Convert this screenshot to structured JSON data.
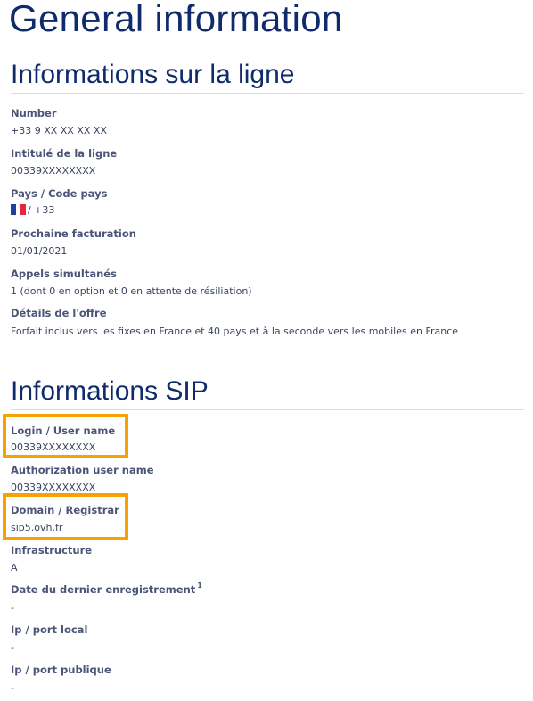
{
  "page": {
    "title": "General information"
  },
  "line_section": {
    "title": "Informations sur la ligne",
    "fields": [
      {
        "label": "Number",
        "value": "+33 9 XX XX XX XX"
      },
      {
        "label": "Intitulé de la ligne",
        "value": "00339XXXXXXXX"
      },
      {
        "label": "Pays / Code pays",
        "value": "/ +33"
      },
      {
        "label": "Prochaine facturation",
        "value": "01/01/2021"
      },
      {
        "label": "Appels simultanés",
        "value": "1 (dont 0 en option et 0 en attente de résiliation)"
      },
      {
        "label": "Détails de l'offre",
        "value": "Forfait inclus vers les fixes en France et 40 pays et à la seconde vers les mobiles en France"
      }
    ]
  },
  "sip_section": {
    "title": "Informations SIP",
    "fields": [
      {
        "label": "Login / User name",
        "value": "00339XXXXXXXX"
      },
      {
        "label": "Authorization user name",
        "value": "00339XXXXXXXX"
      },
      {
        "label": "Domain / Registrar",
        "value": "sip5.ovh.fr"
      },
      {
        "label": "Infrastructure",
        "value": "A"
      },
      {
        "label": "Date du dernier enregistrement",
        "footnote": "1",
        "value": "-"
      },
      {
        "label": "Ip / port local",
        "value": "-"
      },
      {
        "label": "Ip / port publique",
        "value": "-"
      }
    ]
  },
  "flag": {
    "icon": "france-flag-icon",
    "colors": [
      "#1f3fa0",
      "#ffffff",
      "#e8253a"
    ]
  },
  "colors": {
    "heading": "#0f2b6b",
    "label": "#4a5578",
    "value": "#394460",
    "highlight": "#f7a200",
    "divider": "#dcdde2"
  }
}
